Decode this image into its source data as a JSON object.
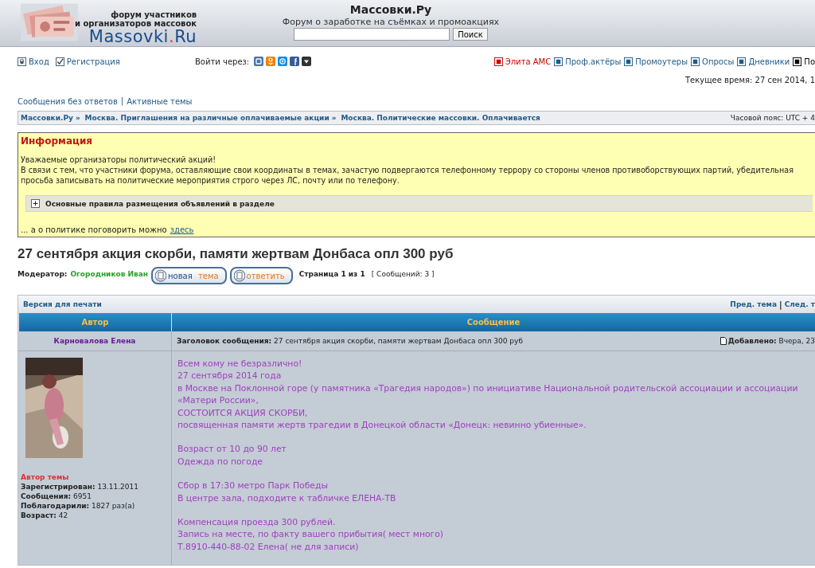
{
  "header": {
    "tagline": [
      "форум участников",
      "и организаторов массовок"
    ],
    "logo_parts": [
      "Massovki",
      ".",
      "Ru"
    ],
    "site_title": "Массовки.Ру",
    "site_subtitle": "Форум о заработке на съёмках и промоакциях",
    "search_button": "Поиск"
  },
  "nav_left": [
    {
      "kind": "login",
      "label": "Вход"
    },
    {
      "kind": "register",
      "label": "Регистрация"
    }
  ],
  "social_label": "Войти через:",
  "social": [
    {
      "kind": "vk",
      "color": "#4a76a8"
    },
    {
      "kind": "ok",
      "color": "#ee8208"
    },
    {
      "kind": "mail",
      "color": "#168de2"
    },
    {
      "kind": "fb",
      "color": "#3b5998"
    },
    {
      "kind": "more",
      "color": "#333333"
    }
  ],
  "nav_right": [
    {
      "label": "Элита АМС",
      "color": "#cc0000"
    },
    {
      "label": "Проф.актёры",
      "color": "#1f5a8a"
    },
    {
      "label": "Промоутеры",
      "color": "#1f5a8a"
    },
    {
      "label": "Опросы",
      "color": "#1f5a8a"
    },
    {
      "label": "Дневники",
      "color": "#1f5a8a"
    },
    {
      "label": "По",
      "color": "#000000"
    }
  ],
  "current_time": "Текущее время: 27 сен 2014, 1",
  "quick_links": [
    "Сообщения без ответов",
    "Активные темы"
  ],
  "quick_links_separator": "|",
  "breadcrumb": {
    "items": [
      "Массовки.Ру",
      "Москва. Приглашения на различные оплачиваемые акции",
      "Москва. Политические массовки. Оплачивается"
    ],
    "separator": "»",
    "timezone": "Часовой пояс: UTC + 4"
  },
  "info": {
    "title": "Информация",
    "paragraphs": [
      "Уважаемые организаторы политический акций!",
      "В связи с тем, что участники форума, оставляющие свои координаты в темах, зачастую подвергаются телефонному террору со стороны членов противоборствующих партий, убедительная просьба записывать на политические мероприятия строго через ЛС, почту или по телефону."
    ],
    "toggle": {
      "symbol": "+",
      "label": "Основные правила размещения объявлений в разделе",
      "expanded": false
    },
    "footer_text": "... а о политике поговорить можно",
    "footer_link": "здесь"
  },
  "topic": {
    "title": "27 сентября акция скорби, памяти жертвам Донбаса опл 300 руб",
    "moderator_label": "Модератор:",
    "moderator": "Огородников Иван",
    "buttons": [
      {
        "kind": "new",
        "parts": [
          "новая",
          "тема"
        ]
      },
      {
        "kind": "reply",
        "parts": [
          "ответить"
        ]
      }
    ],
    "pagination": "Страница 1 из 1",
    "posts_count": "[ Сообщений: 3 ]"
  },
  "toolbar": {
    "print": "Версия для печати",
    "prev": "Пред. тема",
    "separator": "|",
    "next": "След. т"
  },
  "columns": [
    "Автор",
    "Сообщение"
  ],
  "post": {
    "author": "Карновалова Елена",
    "subject": "**Заголовок сообщения:** 27 сентября акция скорби, памяти жертвам Донбаса опл 300 руб",
    "added": "**Добавлено:** Вчера, 23",
    "role": "Автор темы",
    "stats": [
      "**Зарегистрирован:** 13.11.2011",
      "**Сообщения:** 6951",
      "**Поблагодарили:** 1827 раз(а)",
      "**Возраст:** 42"
    ],
    "body": [
      [
        "Всем кому не безразлично!",
        "27 сентября 2014 года",
        "в Москве на Поклонной горе (у памятника «Трагедия народов») по инициативе Национальной родительской ассоциации и ассоциации «Матери России»,",
        "СОСТОИТСЯ АКЦИЯ СКОРБИ,",
        "посвященная памяти жертв трагедии в Донецкой области «Донецк: невинно убиенные»."
      ],
      [
        "Возраст от 10 до 90 лет",
        "Одежда по погоде"
      ],
      [
        "Сбор в 17:30 метро Парк Победы",
        "В центре зала, подходите к табличке ЕЛЕНА-ТВ"
      ],
      [
        "Компенсация проезда 300 рублей.",
        "Запись на месте, по факту вашего прибытия( мест много)",
        "Т.8910-440-88-02 Елена( не для записи)"
      ]
    ]
  }
}
